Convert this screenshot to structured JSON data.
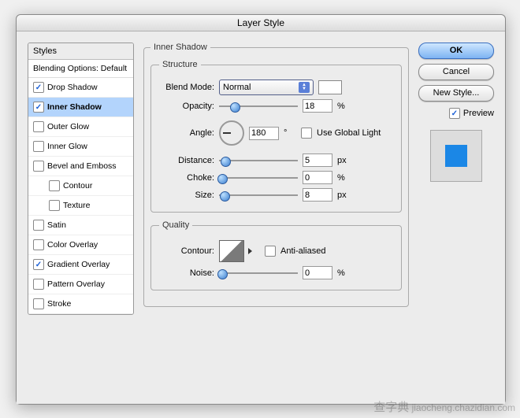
{
  "window_title": "Layer Style",
  "styles": {
    "header": "Styles",
    "blending": "Blending Options: Default",
    "items": [
      {
        "label": "Drop Shadow",
        "checked": true,
        "selected": false,
        "sub": false
      },
      {
        "label": "Inner Shadow",
        "checked": true,
        "selected": true,
        "sub": false
      },
      {
        "label": "Outer Glow",
        "checked": false,
        "selected": false,
        "sub": false
      },
      {
        "label": "Inner Glow",
        "checked": false,
        "selected": false,
        "sub": false
      },
      {
        "label": "Bevel and Emboss",
        "checked": false,
        "selected": false,
        "sub": false
      },
      {
        "label": "Contour",
        "checked": false,
        "selected": false,
        "sub": true
      },
      {
        "label": "Texture",
        "checked": false,
        "selected": false,
        "sub": true
      },
      {
        "label": "Satin",
        "checked": false,
        "selected": false,
        "sub": false
      },
      {
        "label": "Color Overlay",
        "checked": false,
        "selected": false,
        "sub": false
      },
      {
        "label": "Gradient Overlay",
        "checked": true,
        "selected": false,
        "sub": false
      },
      {
        "label": "Pattern Overlay",
        "checked": false,
        "selected": false,
        "sub": false
      },
      {
        "label": "Stroke",
        "checked": false,
        "selected": false,
        "sub": false
      }
    ]
  },
  "panel": {
    "title": "Inner Shadow",
    "structure": {
      "legend": "Structure",
      "blend_mode_label": "Blend Mode:",
      "blend_mode_value": "Normal",
      "opacity_label": "Opacity:",
      "opacity_value": "18",
      "opacity_unit": "%",
      "angle_label": "Angle:",
      "angle_value": "180",
      "angle_unit": "°",
      "global_light_label": "Use Global Light",
      "global_light_checked": false,
      "distance_label": "Distance:",
      "distance_value": "5",
      "distance_unit": "px",
      "choke_label": "Choke:",
      "choke_value": "0",
      "choke_unit": "%",
      "size_label": "Size:",
      "size_value": "8",
      "size_unit": "px"
    },
    "quality": {
      "legend": "Quality",
      "contour_label": "Contour:",
      "anti_aliased_label": "Anti-aliased",
      "anti_aliased_checked": false,
      "noise_label": "Noise:",
      "noise_value": "0",
      "noise_unit": "%"
    }
  },
  "buttons": {
    "ok": "OK",
    "cancel": "Cancel",
    "new_style": "New Style...",
    "preview": "Preview"
  },
  "watermark": {
    "cn": "查字典",
    "en": "jiaocheng.chazidian.com"
  }
}
